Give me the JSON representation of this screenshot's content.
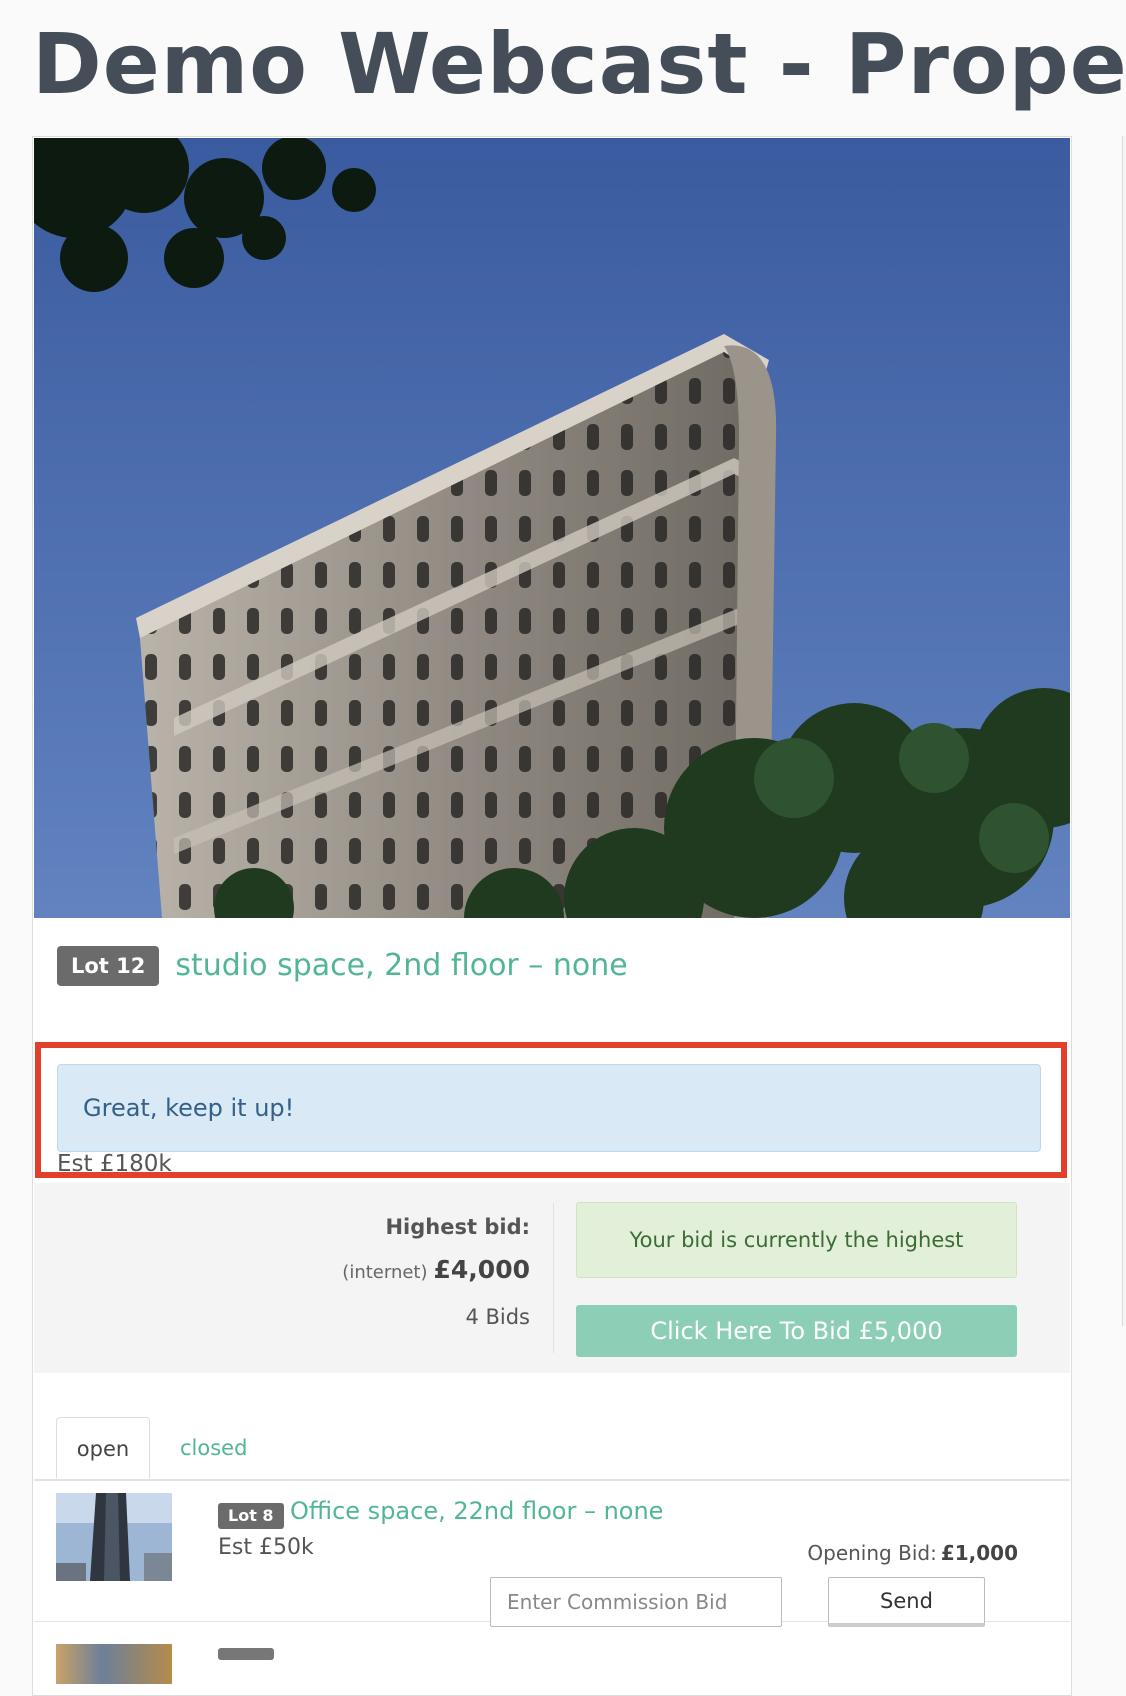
{
  "page": {
    "title": "Demo Webcast - Propert"
  },
  "lot": {
    "badge": "Lot 12",
    "title": "studio space, 2nd floor – none",
    "estimate": "Est £180k",
    "status_message": "Great, keep it up!"
  },
  "bidding": {
    "highest_label": "Highest bid:",
    "source": "(internet)",
    "amount": "£4,000",
    "count": "4 Bids",
    "status": "Your bid is currently the highest",
    "bid_button": "Click Here To Bid £5,000"
  },
  "tabs": [
    {
      "label": "open",
      "active": true
    },
    {
      "label": "closed",
      "active": false
    }
  ],
  "items": [
    {
      "badge": "Lot 8",
      "title": "Office space, 22nd floor – none",
      "estimate": "Est £50k",
      "opening_label": "Opening Bid:",
      "opening_value": "£1,000",
      "commission_placeholder": "Enter Commission Bid",
      "send_label": "Send"
    }
  ],
  "colors": {
    "accent": "#52b597",
    "highlight_frame": "#e3402c",
    "info_bg": "#d9e9f6",
    "success_bg": "#e2efd9",
    "bid_button": "#8ccfb6"
  }
}
